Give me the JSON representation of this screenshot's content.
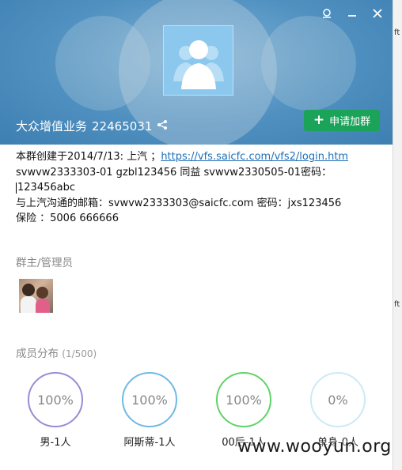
{
  "header": {
    "group_name": "大众增值业务",
    "group_id": "22465031",
    "join_label": "申请加群"
  },
  "colors": {
    "join_button": "#1ba35a",
    "link": "#1f6fb5",
    "header_blue": "#4f90c0"
  },
  "description": {
    "line1_prefix": "本群创建于2014/7/13:  上汽 ；",
    "line1_link": "https://vfs.saicfc.com/vfs2/login.htm",
    "line2": "svwvw2333303-01    gzbl123456   同益  svwvw2330505-01密码：",
    "line3": "123456abc",
    "line4": "与上汽沟通的邮箱：svwvw2333303@saicfc.com    密码：jxs123456",
    "line5": "保险 ：5006  666666"
  },
  "sections": {
    "admins_title": "群主/管理员",
    "members_title": "成员分布",
    "members_count": "(1/500)"
  },
  "stats": [
    {
      "percent": "100%",
      "label": "男-1人",
      "color": "#9b8ad6"
    },
    {
      "percent": "100%",
      "label": "阿斯蒂-1人",
      "color": "#6fb9e6"
    },
    {
      "percent": "100%",
      "label": "00后-1人",
      "color": "#5fd36a"
    },
    {
      "percent": "0%",
      "label": "单身-0人",
      "color": "#cde9f6"
    }
  ],
  "edge": {
    "peek_top": "ft",
    "peek_mid": "ft"
  },
  "watermark": "www.wooyun.org",
  "icons": {
    "pin": "pin-icon",
    "minimize": "minimize-icon",
    "close": "close-icon",
    "share": "share-icon",
    "group_avatar": "group-users-icon"
  }
}
